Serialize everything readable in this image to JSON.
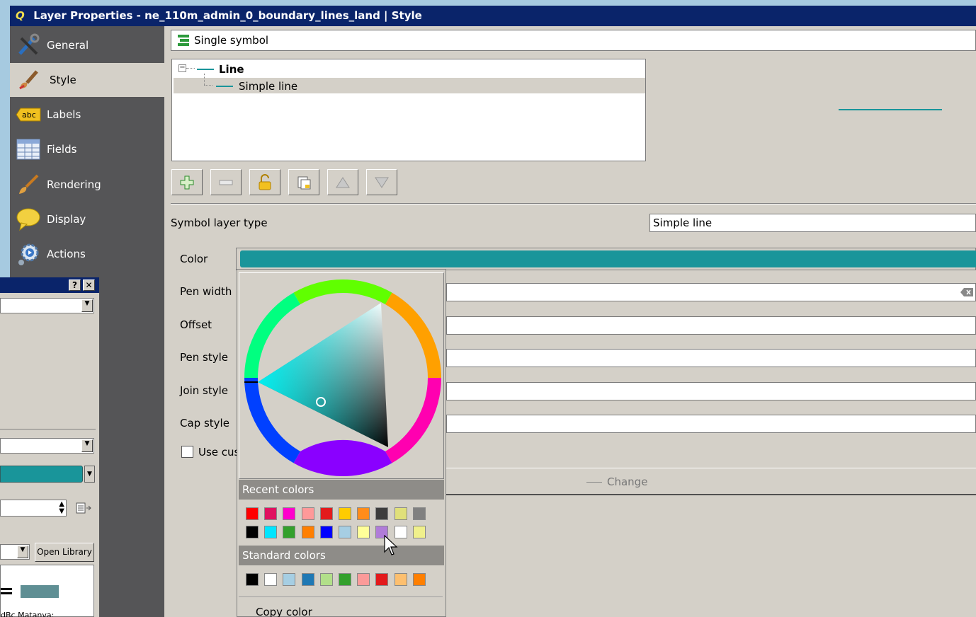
{
  "window": {
    "title": "Layer Properties - ne_110m_admin_0_boundary_lines_land | Style"
  },
  "sidebar": {
    "items": [
      {
        "label": "General",
        "icon": "tools-icon"
      },
      {
        "label": "Style",
        "icon": "brush-icon"
      },
      {
        "label": "Labels",
        "icon": "abc-label-icon"
      },
      {
        "label": "Fields",
        "icon": "table-icon"
      },
      {
        "label": "Rendering",
        "icon": "paintbrush-icon"
      },
      {
        "label": "Display",
        "icon": "speech-bubble-icon"
      },
      {
        "label": "Actions",
        "icon": "gear-actions-icon"
      }
    ]
  },
  "renderer": {
    "value": "Single symbol"
  },
  "symbol_tree": {
    "root": "Line",
    "child": "Simple line"
  },
  "symbol_layer_type": {
    "label": "Symbol layer type",
    "value": "Simple line"
  },
  "properties": {
    "color_label": "Color",
    "color_value": "#19959a",
    "pen_width": "Pen width",
    "offset": "Offset",
    "pen_style": "Pen style",
    "join_style": "Join style",
    "cap_style": "Cap style",
    "use_custom": "Use cus",
    "change": "Change"
  },
  "side_panel": {
    "open_library": "Open Library",
    "bottom_text": "dBc Matanva:"
  },
  "color_popup": {
    "recent_label": "Recent colors",
    "standard_label": "Standard colors",
    "copy_label": "Copy color",
    "recent_row1": [
      "#ff0000",
      "#e0115f",
      "#ff00cc",
      "#ff9999",
      "#e31a1c",
      "#ffcc00",
      "#ff8c1a",
      "#3d3d3d",
      "#e0e07a",
      "#808080"
    ],
    "recent_row2": [
      "#000000",
      "#00e5ff",
      "#33a02c",
      "#ff7f00",
      "#0000ff",
      "#a6cee3",
      "#ffff99",
      "#b07cd8",
      "#ffffff",
      "#f0f08c"
    ],
    "standard": [
      "#000000",
      "#ffffff",
      "#a6cee3",
      "#1f78b4",
      "#b2df8a",
      "#33a02c",
      "#fb9a99",
      "#e31a1c",
      "#fdbf6f",
      "#ff7f00"
    ]
  }
}
